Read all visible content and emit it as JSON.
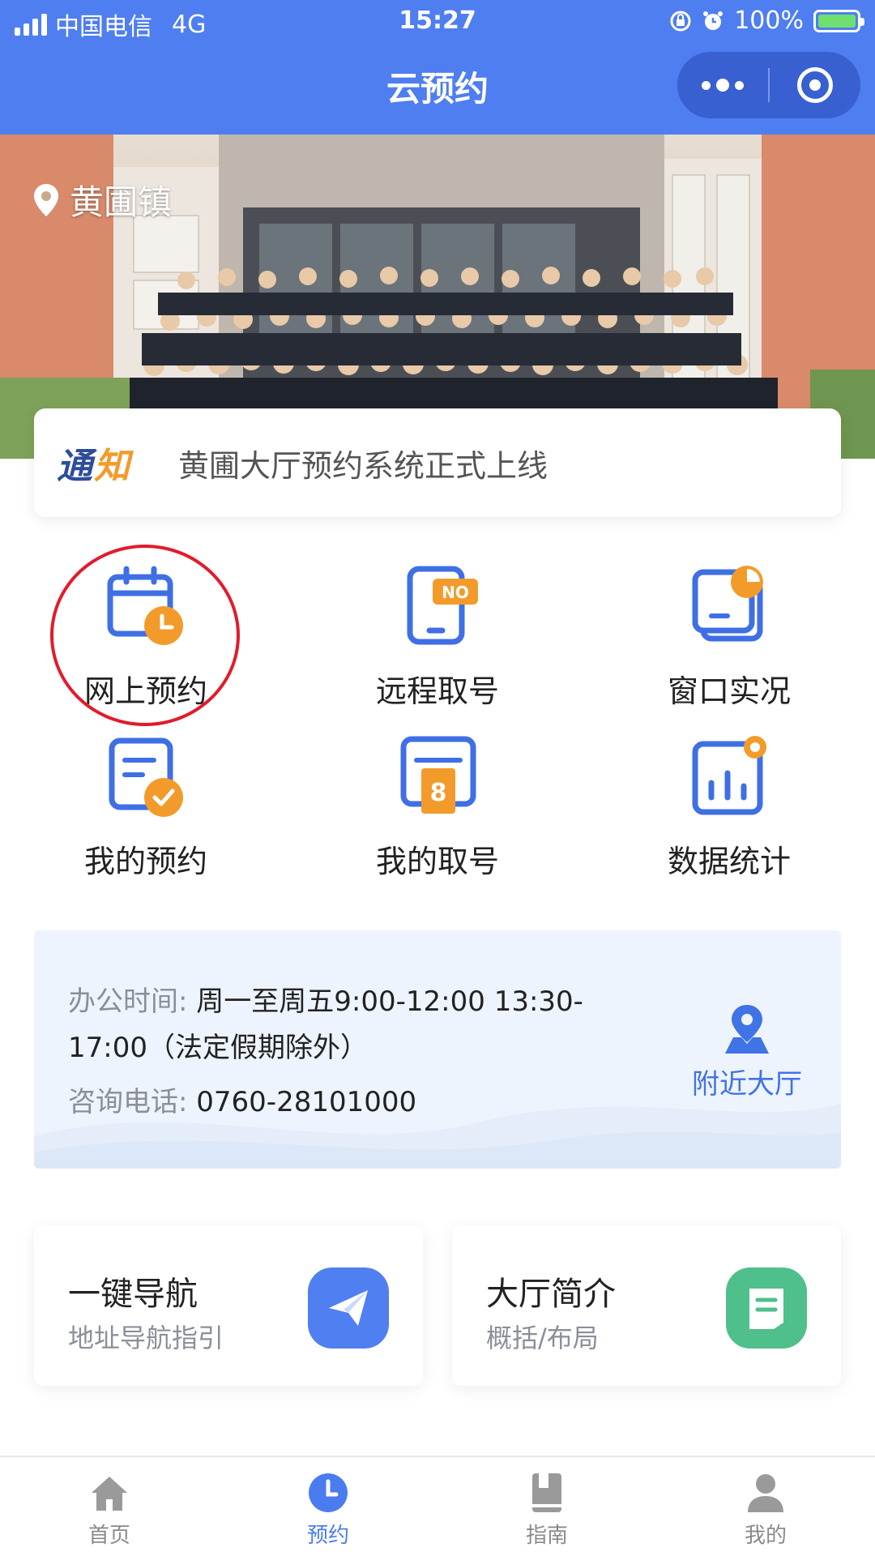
{
  "status_bar": {
    "carrier": "中国电信",
    "network": "4G",
    "time": "15:27",
    "battery": "100%"
  },
  "nav": {
    "title": "云预约"
  },
  "banner": {
    "location": "黄圃镇"
  },
  "notice": {
    "tag_part1": "通",
    "tag_part2": "知",
    "text": "黄圃大厅预约系统正式上线"
  },
  "grid": [
    {
      "label": "网上预约",
      "icon": "calendar-clock-icon"
    },
    {
      "label": "远程取号",
      "icon": "phone-no-icon"
    },
    {
      "label": "窗口实况",
      "icon": "window-live-icon"
    },
    {
      "label": "我的预约",
      "icon": "doc-check-icon"
    },
    {
      "label": "我的取号",
      "icon": "ticket-number-icon"
    },
    {
      "label": "数据统计",
      "icon": "chart-icon"
    }
  ],
  "ticket_number": "8",
  "no_badge": "NO",
  "info": {
    "hours_label": "办公时间:",
    "hours_value": "周一至周五9:00-12:00 13:30-",
    "hours_value_2": "17:00（法定假期除外）",
    "phone_label": "咨询电话:",
    "phone_value": "0760-28101000",
    "nearby_label": "附近大厅"
  },
  "cards": [
    {
      "title": "一键导航",
      "subtitle": "地址导航指引",
      "icon": "paper-plane-icon",
      "color": "#4f7ff0"
    },
    {
      "title": "大厅简介",
      "subtitle": "概括/布局",
      "icon": "document-icon",
      "color": "#4fbf8c"
    }
  ],
  "tabs": [
    {
      "label": "首页",
      "icon": "home-icon",
      "active": false
    },
    {
      "label": "预约",
      "icon": "clock-icon",
      "active": true
    },
    {
      "label": "指南",
      "icon": "book-icon",
      "active": false
    },
    {
      "label": "我的",
      "icon": "user-icon",
      "active": false
    }
  ],
  "colors": {
    "primary": "#4e7ef0",
    "accent": "#f39b2a",
    "highlight_circle": "#e21b2b"
  }
}
